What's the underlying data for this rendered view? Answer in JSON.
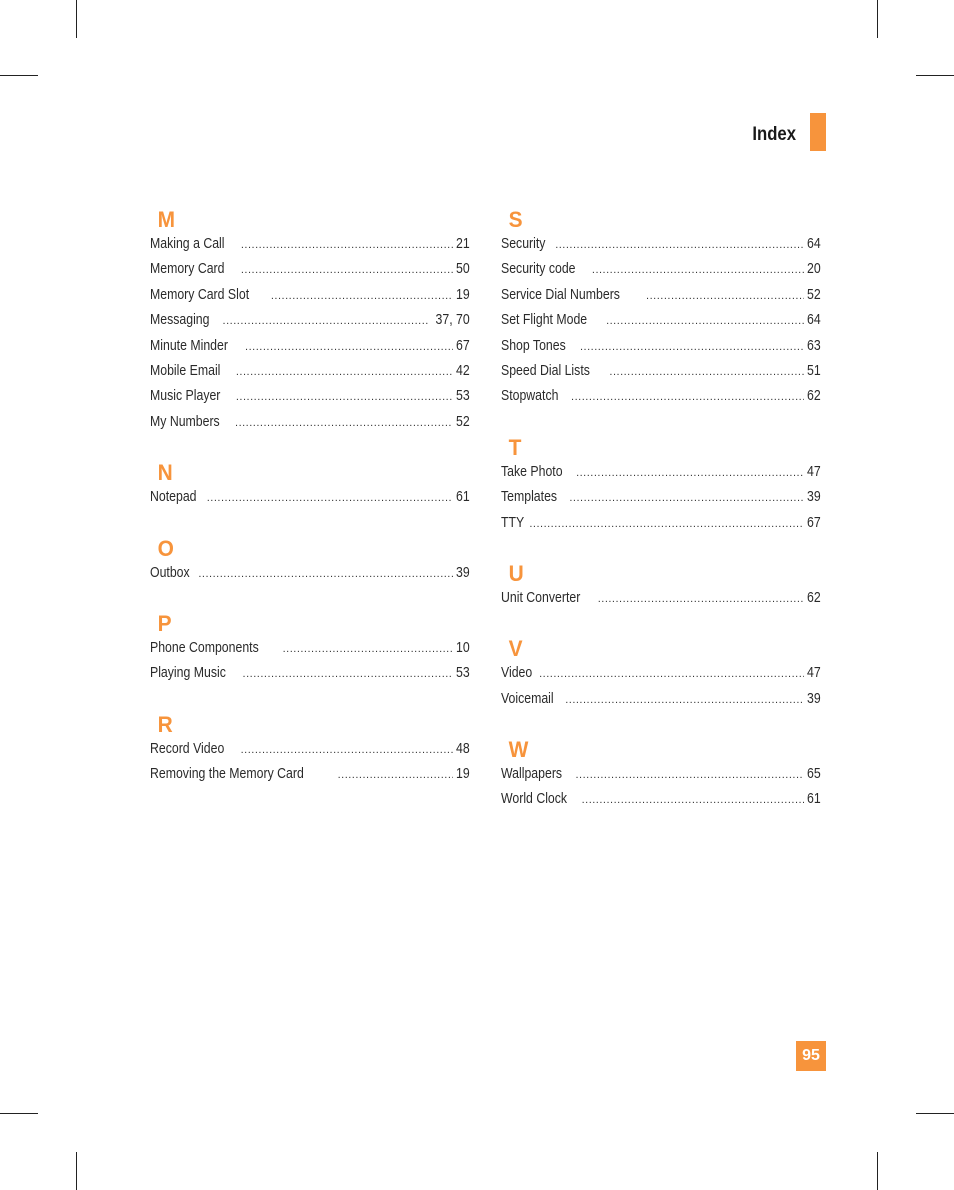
{
  "header": {
    "title": "Index"
  },
  "page_number": "95",
  "accent_color": "#f7943c",
  "columns": [
    [
      {
        "letter": "M",
        "entries": [
          {
            "name": "Making a Call",
            "page": "21"
          },
          {
            "name": "Memory Card",
            "page": "50"
          },
          {
            "name": "Memory Card Slot",
            "page": "19"
          },
          {
            "name": "Messaging",
            "page": "37, 70"
          },
          {
            "name": "Minute Minder",
            "page": "67"
          },
          {
            "name": "Mobile Email",
            "page": "42"
          },
          {
            "name": "Music Player",
            "page": "53"
          },
          {
            "name": "My Numbers",
            "page": "52"
          }
        ]
      },
      {
        "letter": "N",
        "entries": [
          {
            "name": "Notepad",
            "page": "61"
          }
        ]
      },
      {
        "letter": "O",
        "entries": [
          {
            "name": "Outbox",
            "page": "39"
          }
        ]
      },
      {
        "letter": "P",
        "entries": [
          {
            "name": "Phone Components",
            "page": "10"
          },
          {
            "name": "Playing Music",
            "page": "53"
          }
        ]
      },
      {
        "letter": "R",
        "entries": [
          {
            "name": "Record Video",
            "page": "48"
          },
          {
            "name": "Removing the Memory Card",
            "page": "19"
          }
        ]
      }
    ],
    [
      {
        "letter": "S",
        "entries": [
          {
            "name": "Security",
            "page": "64"
          },
          {
            "name": "Security code",
            "page": "20"
          },
          {
            "name": "Service Dial Numbers",
            "page": "52"
          },
          {
            "name": "Set Flight Mode",
            "page": "64"
          },
          {
            "name": "Shop Tones",
            "page": "63"
          },
          {
            "name": "Speed Dial Lists",
            "page": "51"
          },
          {
            "name": "Stopwatch",
            "page": "62"
          }
        ]
      },
      {
        "letter": "T",
        "entries": [
          {
            "name": "Take Photo",
            "page": "47"
          },
          {
            "name": "Templates",
            "page": "39"
          },
          {
            "name": "TTY",
            "page": "67"
          }
        ]
      },
      {
        "letter": "U",
        "entries": [
          {
            "name": "Unit Converter",
            "page": "62"
          }
        ]
      },
      {
        "letter": "V",
        "entries": [
          {
            "name": "Video",
            "page": "47"
          },
          {
            "name": "Voicemail",
            "page": "39"
          }
        ]
      },
      {
        "letter": "W",
        "entries": [
          {
            "name": "Wallpapers",
            "page": "65"
          },
          {
            "name": "World Clock",
            "page": "61"
          }
        ]
      }
    ]
  ]
}
